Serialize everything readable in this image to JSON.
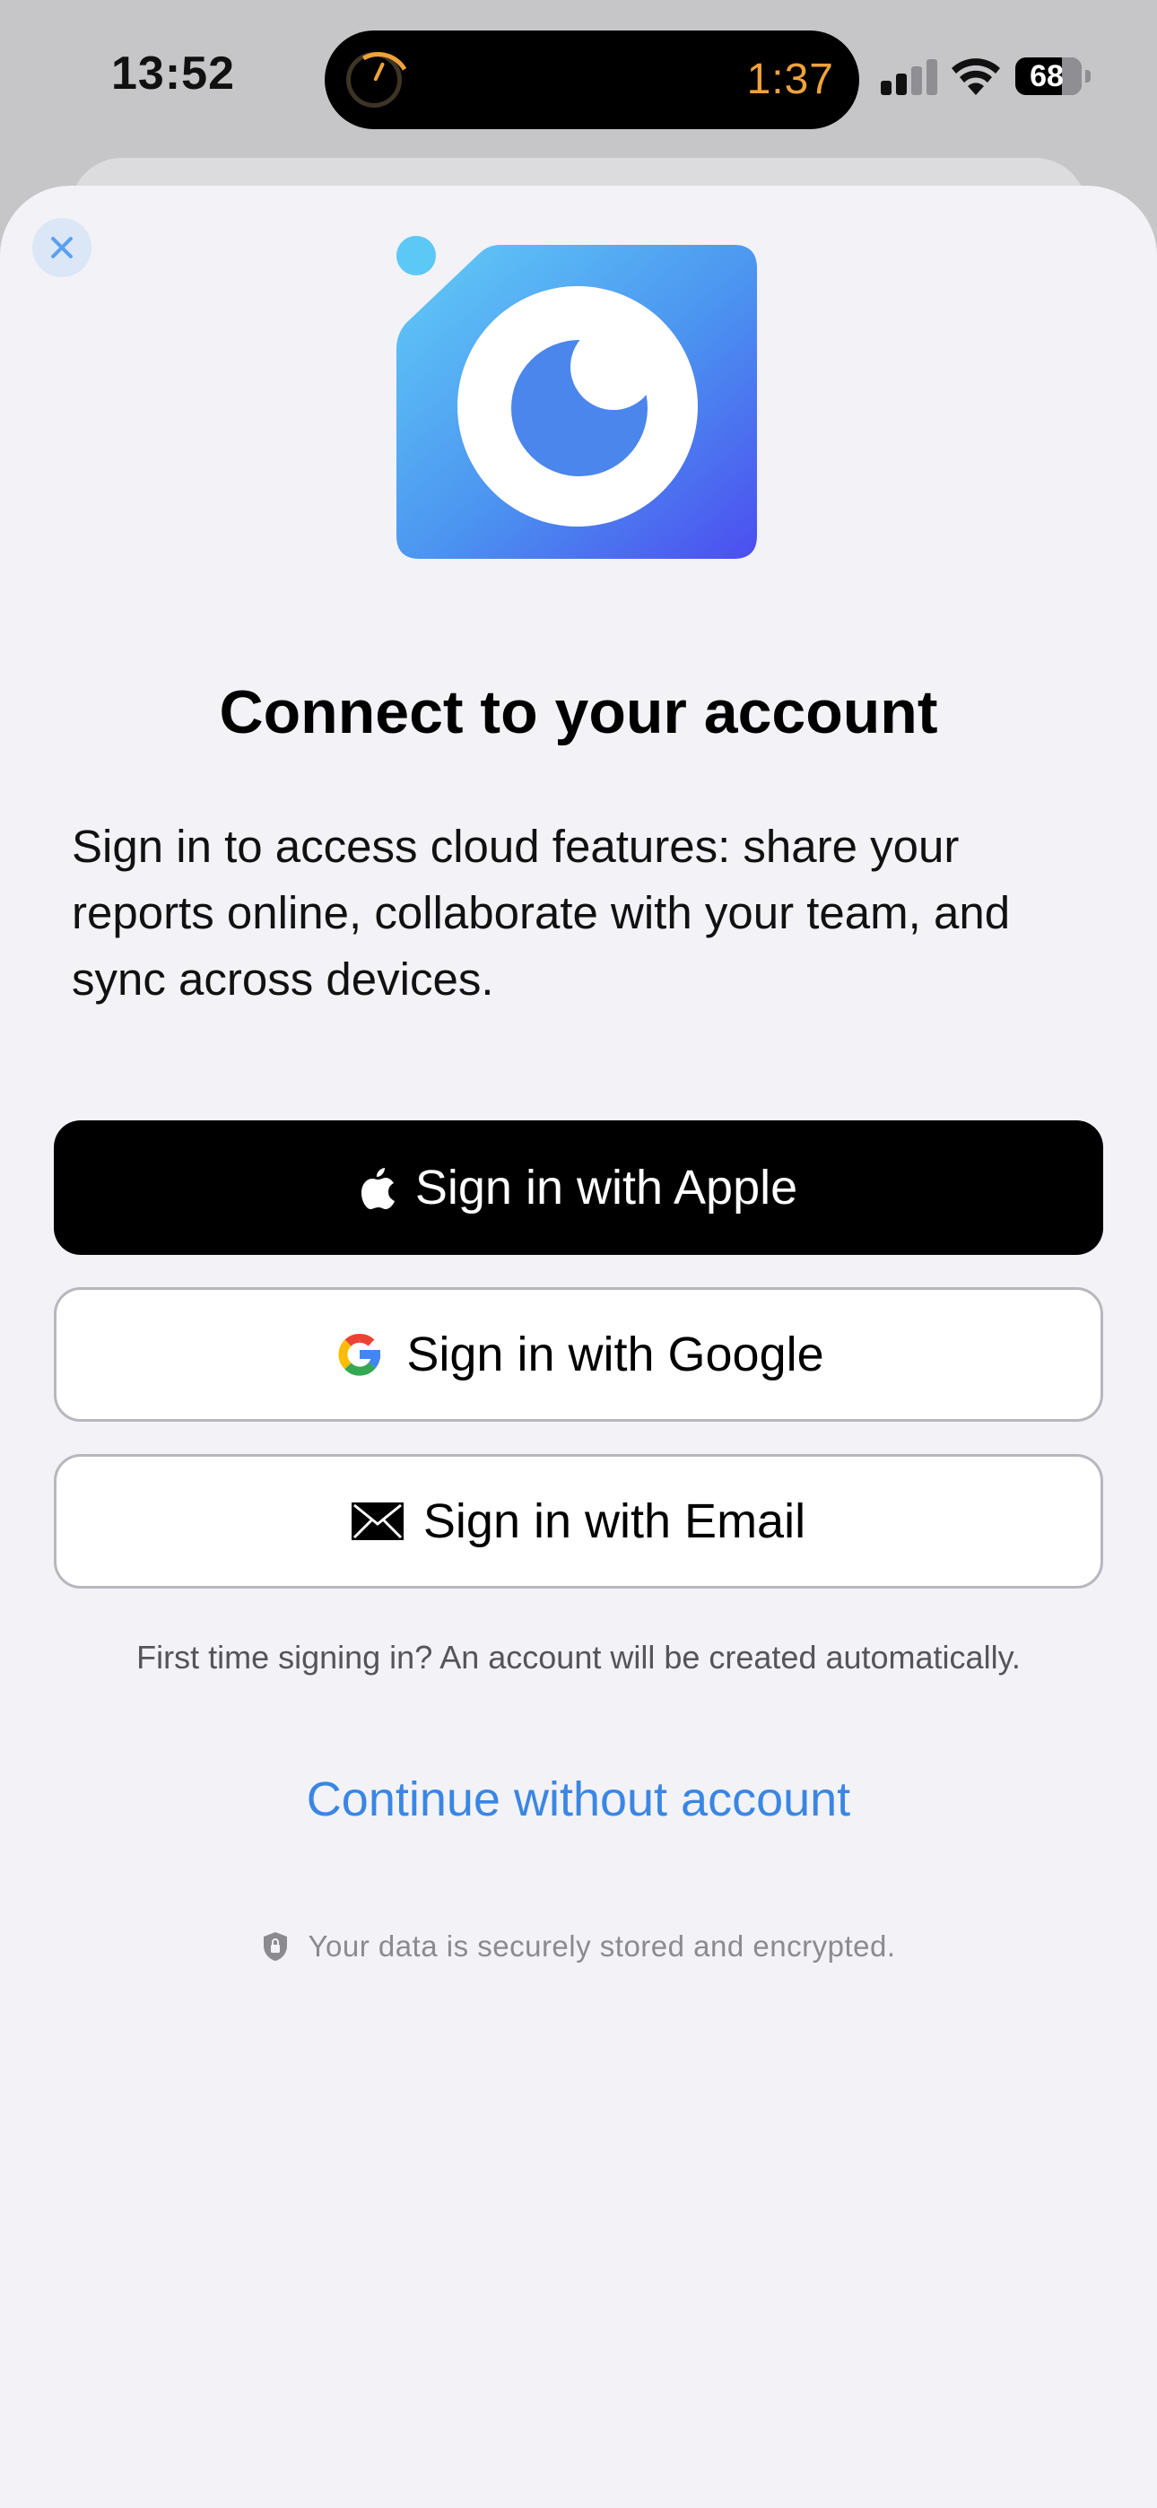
{
  "status_bar": {
    "time": "13:52",
    "timer": "1:37",
    "battery": "68"
  },
  "colors": {
    "accent": "#3a86e3",
    "timer": "#f0a23b",
    "sheet_bg": "#f2f2f7"
  },
  "icons": {
    "close": "close-icon",
    "logo": "app-logo-icon",
    "apple": "apple-icon",
    "google": "google-icon",
    "email": "envelope-icon",
    "secure": "shield-lock-icon"
  },
  "main": {
    "title": "Connect to your account",
    "description": "Sign in to access cloud features: share your reports online, collaborate with your team, and sync across devices.",
    "buttons": {
      "apple": "Sign in with Apple",
      "google": "Sign in with Google",
      "email": "Sign in with Email"
    },
    "note": "First time signing in? An account will be created automatically.",
    "continue_label": "Continue without account",
    "secure_text": "Your data is securely stored and encrypted."
  }
}
